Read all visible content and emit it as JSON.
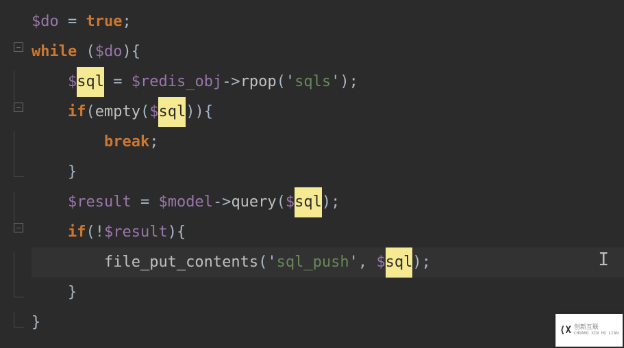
{
  "chart_data": null,
  "highlight_token": "sql",
  "code_lines": [
    {
      "indent": "",
      "tokens": [
        {
          "cls": "var",
          "t": "$do"
        },
        {
          "cls": "op",
          "t": " = "
        },
        {
          "cls": "kw",
          "t": "true"
        },
        {
          "cls": "punct",
          "t": ";"
        }
      ]
    },
    {
      "indent": "",
      "tokens": [
        {
          "cls": "kw",
          "t": "while"
        },
        {
          "cls": "op",
          "t": " ("
        },
        {
          "cls": "var",
          "t": "$do"
        },
        {
          "cls": "punct",
          "t": "){"
        }
      ]
    },
    {
      "indent": "    ",
      "tokens": [
        {
          "cls": "var",
          "t": "$"
        },
        {
          "cls": "sel",
          "t": "sql"
        },
        {
          "cls": "op",
          "t": " = "
        },
        {
          "cls": "var",
          "t": "$redis_obj"
        },
        {
          "cls": "op",
          "t": "->"
        },
        {
          "cls": "fn",
          "t": "rpop"
        },
        {
          "cls": "punct",
          "t": "('"
        },
        {
          "cls": "str",
          "t": "sqls"
        },
        {
          "cls": "punct",
          "t": "');"
        }
      ]
    },
    {
      "indent": "    ",
      "tokens": [
        {
          "cls": "kw",
          "t": "if"
        },
        {
          "cls": "punct",
          "t": "("
        },
        {
          "cls": "fn",
          "t": "empty"
        },
        {
          "cls": "punct",
          "t": "("
        },
        {
          "cls": "var",
          "t": "$"
        },
        {
          "cls": "sel",
          "t": "sql"
        },
        {
          "cls": "punct",
          "t": ")){"
        }
      ]
    },
    {
      "indent": "        ",
      "tokens": [
        {
          "cls": "kw",
          "t": "break"
        },
        {
          "cls": "punct",
          "t": ";"
        }
      ]
    },
    {
      "indent": "    ",
      "tokens": [
        {
          "cls": "punct",
          "t": "}"
        }
      ]
    },
    {
      "indent": "    ",
      "tokens": [
        {
          "cls": "var",
          "t": "$result"
        },
        {
          "cls": "op",
          "t": " = "
        },
        {
          "cls": "var",
          "t": "$model"
        },
        {
          "cls": "op",
          "t": "->"
        },
        {
          "cls": "fn",
          "t": "query"
        },
        {
          "cls": "punct",
          "t": "("
        },
        {
          "cls": "var",
          "t": "$"
        },
        {
          "cls": "sel",
          "t": "sql"
        },
        {
          "cls": "punct",
          "t": ");"
        }
      ]
    },
    {
      "indent": "    ",
      "tokens": [
        {
          "cls": "kw",
          "t": "if"
        },
        {
          "cls": "punct",
          "t": "(!"
        },
        {
          "cls": "var",
          "t": "$result"
        },
        {
          "cls": "punct",
          "t": "){"
        }
      ]
    },
    {
      "indent": "        ",
      "hl": true,
      "tokens": [
        {
          "cls": "fn",
          "t": "file_put_contents"
        },
        {
          "cls": "punct",
          "t": "('"
        },
        {
          "cls": "str",
          "t": "sql_push"
        },
        {
          "cls": "punct",
          "t": "', "
        },
        {
          "cls": "var",
          "t": "$"
        },
        {
          "cls": "sel",
          "t": "sql"
        },
        {
          "cls": "punct",
          "t": ");"
        }
      ]
    },
    {
      "indent": "    ",
      "tokens": [
        {
          "cls": "punct",
          "t": "}"
        }
      ]
    },
    {
      "indent": "",
      "tokens": [
        {
          "cls": "punct",
          "t": "}"
        }
      ]
    }
  ],
  "watermark": {
    "brand": "创新互联",
    "sub": "CHUANG XIN HU LIAN"
  }
}
